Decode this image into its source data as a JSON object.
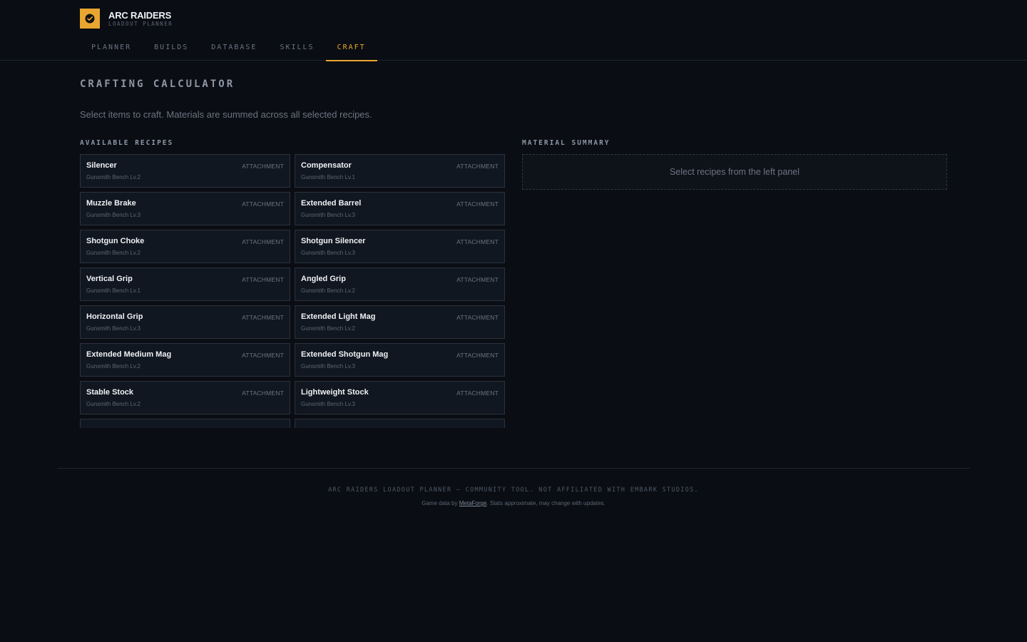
{
  "brand": {
    "title": "ARC RAIDERS",
    "subtitle": "LOADOUT PLANNER",
    "accent": "#e8a630",
    "logo_icon": "check-badge-icon"
  },
  "nav": {
    "tabs": [
      "PLANNER",
      "BUILDS",
      "DATABASE",
      "SKILLS",
      "CRAFT"
    ],
    "active": "CRAFT"
  },
  "page": {
    "title": "CRAFTING CALCULATOR",
    "description": "Select items to craft. Materials are summed across all selected recipes."
  },
  "recipes": {
    "label": "AVAILABLE RECIPES",
    "items": [
      {
        "name": "Silencer",
        "bench": "Gunsmith Bench Lv.2",
        "type": "ATTACHMENT"
      },
      {
        "name": "Compensator",
        "bench": "Gunsmith Bench Lv.1",
        "type": "ATTACHMENT"
      },
      {
        "name": "Muzzle Brake",
        "bench": "Gunsmith Bench Lv.3",
        "type": "ATTACHMENT"
      },
      {
        "name": "Extended Barrel",
        "bench": "Gunsmith Bench Lv.3",
        "type": "ATTACHMENT"
      },
      {
        "name": "Shotgun Choke",
        "bench": "Gunsmith Bench Lv.2",
        "type": "ATTACHMENT"
      },
      {
        "name": "Shotgun Silencer",
        "bench": "Gunsmith Bench Lv.3",
        "type": "ATTACHMENT"
      },
      {
        "name": "Vertical Grip",
        "bench": "Gunsmith Bench Lv.1",
        "type": "ATTACHMENT"
      },
      {
        "name": "Angled Grip",
        "bench": "Gunsmith Bench Lv.2",
        "type": "ATTACHMENT"
      },
      {
        "name": "Horizontal Grip",
        "bench": "Gunsmith Bench Lv.3",
        "type": "ATTACHMENT"
      },
      {
        "name": "Extended Light Mag",
        "bench": "Gunsmith Bench Lv.2",
        "type": "ATTACHMENT"
      },
      {
        "name": "Extended Medium Mag",
        "bench": "Gunsmith Bench Lv.2",
        "type": "ATTACHMENT"
      },
      {
        "name": "Extended Shotgun Mag",
        "bench": "Gunsmith Bench Lv.3",
        "type": "ATTACHMENT"
      },
      {
        "name": "Stable Stock",
        "bench": "Gunsmith Bench Lv.2",
        "type": "ATTACHMENT"
      },
      {
        "name": "Lightweight Stock",
        "bench": "Gunsmith Bench Lv.3",
        "type": "ATTACHMENT"
      }
    ]
  },
  "summary": {
    "label": "MATERIAL SUMMARY",
    "empty_text": "Select recipes from the left panel"
  },
  "footer": {
    "main": "ARC RAIDERS LOADOUT PLANNER — COMMUNITY TOOL. NOT AFFILIATED WITH EMBARK STUDIOS.",
    "credit_prefix": "Game data by ",
    "credit_link": "MetaForge",
    "credit_suffix": ". Stats approximate, may change with updates."
  }
}
